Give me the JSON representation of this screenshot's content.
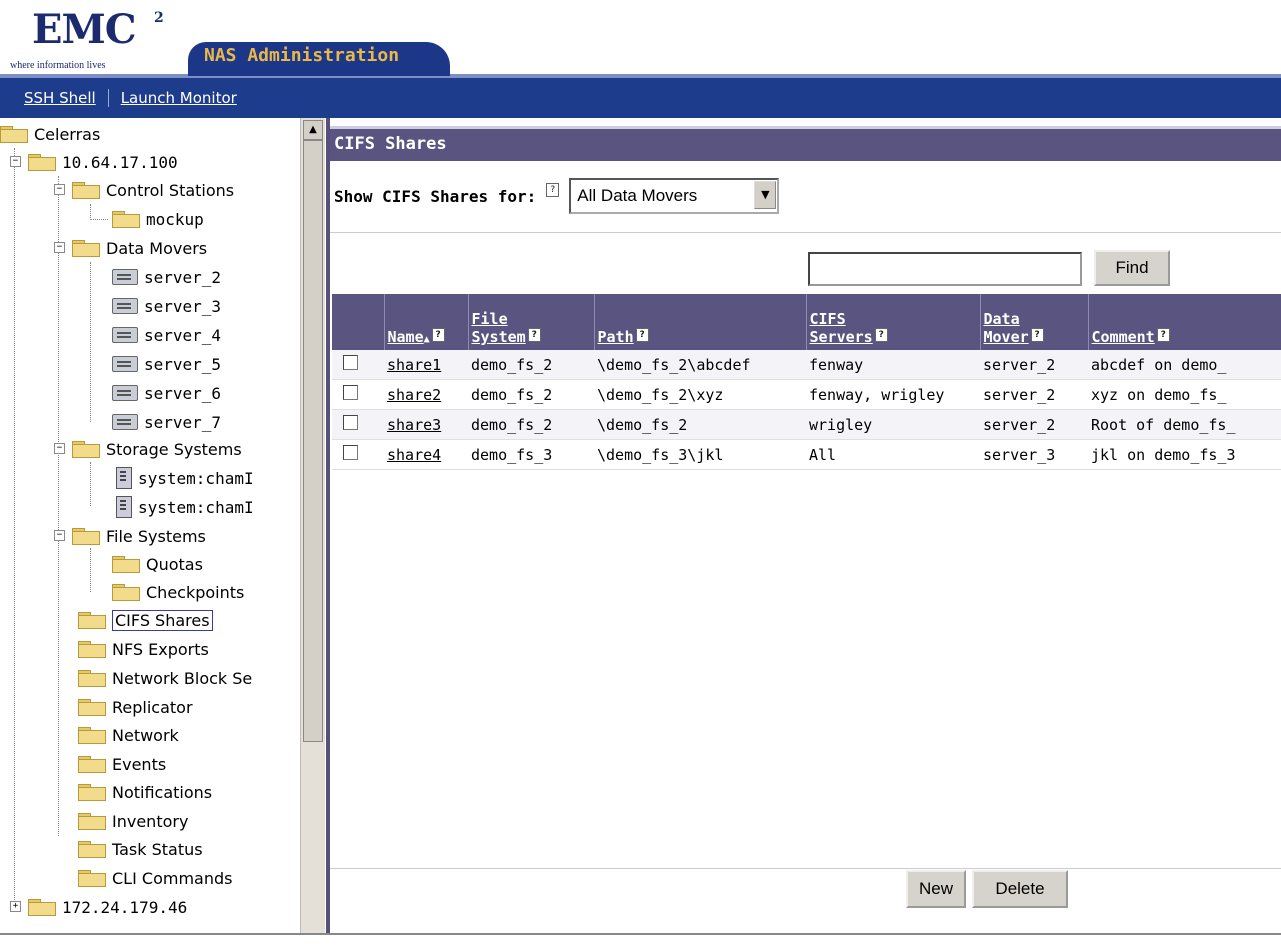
{
  "brand": {
    "logo": "EMC",
    "logo_sup": "2",
    "tagline": "where information lives",
    "app_title": "NAS Administration"
  },
  "toolbar": {
    "ssh_shell": "SSH Shell",
    "launch_monitor": "Launch Monitor"
  },
  "tree": {
    "root": "Celerras",
    "host1": "10.64.17.100",
    "control_stations": "Control Stations",
    "mockup": "mockup",
    "data_movers": "Data Movers",
    "servers": [
      "server_2",
      "server_3",
      "server_4",
      "server_5",
      "server_6",
      "server_7"
    ],
    "storage_systems": "Storage Systems",
    "systems": [
      "system:chamI",
      "system:chamI"
    ],
    "file_systems": "File Systems",
    "quotas": "Quotas",
    "checkpoints": "Checkpoints",
    "items": [
      "CIFS Shares",
      "NFS Exports",
      "Network Block Se",
      "Replicator",
      "Network",
      "Events",
      "Notifications",
      "Inventory",
      "Task Status",
      "CLI Commands"
    ],
    "host2": "172.24.179.46",
    "selected": "CIFS Shares"
  },
  "main": {
    "section_title": "CIFS Shares",
    "show_label": "Show CIFS Shares for:",
    "help_glyph": "?",
    "data_mover_select": "All Data Movers",
    "find_button": "Find",
    "new_button": "New",
    "delete_button": "Delete"
  },
  "table": {
    "columns": [
      {
        "label_line1": "",
        "label_line2": "Name",
        "sort": "▲"
      },
      {
        "label_line1": "File",
        "label_line2": "System"
      },
      {
        "label_line1": "",
        "label_line2": "Path"
      },
      {
        "label_line1": "CIFS",
        "label_line2": "Servers"
      },
      {
        "label_line1": "Data",
        "label_line2": "Mover"
      },
      {
        "label_line1": "",
        "label_line2": "Comment"
      }
    ],
    "rows": [
      {
        "name": "share1",
        "file_system": "demo_fs_2",
        "path": "\\demo_fs_2\\abcdef",
        "cifs_servers": "fenway",
        "data_mover": "server_2",
        "comment": "abcdef on demo_"
      },
      {
        "name": "share2",
        "file_system": "demo_fs_2",
        "path": "\\demo_fs_2\\xyz",
        "cifs_servers": "fenway, wrigley",
        "data_mover": "server_2",
        "comment": "xyz on demo_fs_"
      },
      {
        "name": "share3",
        "file_system": "demo_fs_2",
        "path": "\\demo_fs_2",
        "cifs_servers": "wrigley",
        "data_mover": "server_2",
        "comment": "Root of demo_fs_"
      },
      {
        "name": "share4",
        "file_system": "demo_fs_3",
        "path": "\\demo_fs_3\\jkl",
        "cifs_servers": "All",
        "data_mover": "server_3",
        "comment": "jkl on demo_fs_3"
      }
    ]
  },
  "colors": {
    "header_blue": "#1e3c8c",
    "title_gold": "#e8b84a",
    "panel_purple": "#5a5580"
  }
}
